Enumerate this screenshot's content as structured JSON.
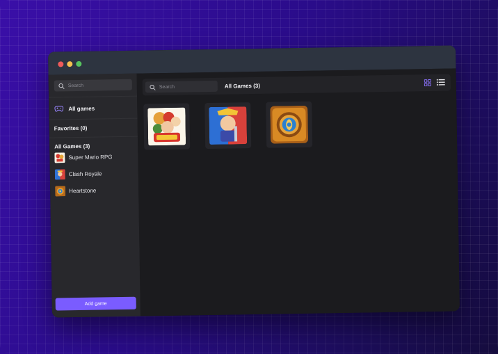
{
  "sidebar": {
    "search_placeholder": "Search",
    "all_games_label": "All games",
    "favorites_heading": "Favorites (0)",
    "all_games_heading": "All Games (3)",
    "games": [
      {
        "name": "Super Mario RPG",
        "icon": "super-mario-rpg-art"
      },
      {
        "name": "Clash Royale",
        "icon": "clash-royale-art"
      },
      {
        "name": "Heartstone",
        "icon": "hearthstone-art"
      }
    ],
    "add_button_label": "Add game"
  },
  "main": {
    "search_placeholder": "Search",
    "title": "All Games (3)",
    "view_modes": [
      "grid-view-icon",
      "list-view-icon"
    ],
    "active_view": "grid"
  },
  "colors": {
    "accent": "#7a5cff",
    "window_bg": "#1d1d20",
    "sidebar_bg": "#28282c",
    "titlebar_bg": "#2d3440"
  }
}
